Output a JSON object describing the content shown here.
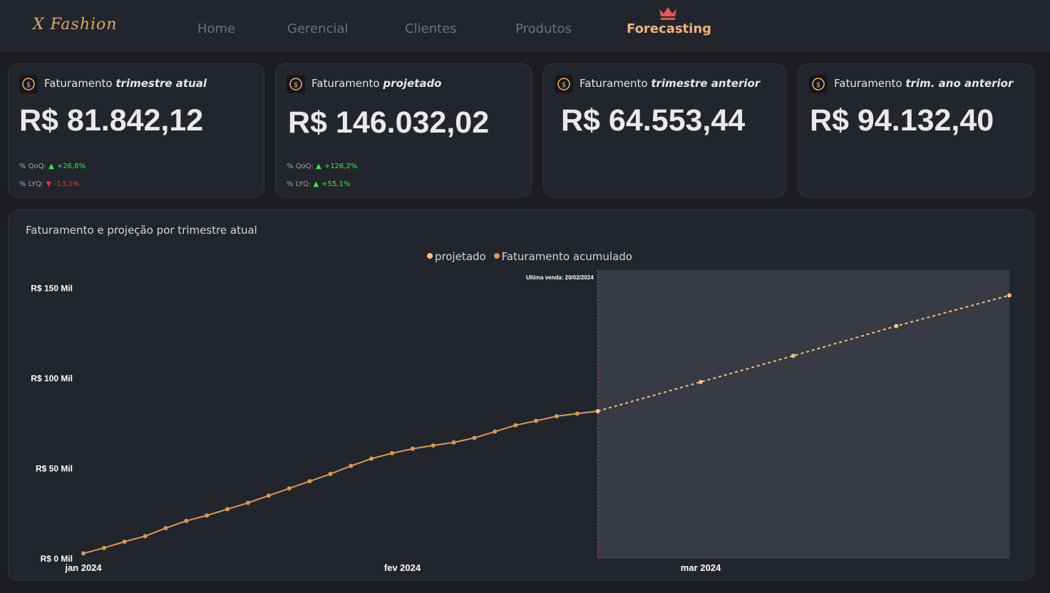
{
  "app": {
    "logo": "X Fashion"
  },
  "nav": {
    "items": [
      {
        "label": "Home"
      },
      {
        "label": "Gerencial"
      },
      {
        "label": "Clientes"
      },
      {
        "label": "Produtos"
      },
      {
        "label": "Forecasting"
      }
    ],
    "active": "Forecasting",
    "active_icon": "crown-icon",
    "active_color": "#f2b37b"
  },
  "cards": [
    {
      "title_prefix": "Faturamento",
      "title_emphasis": "trimestre atual",
      "value": "R$ 81.842,12",
      "qoq_label": "% QoQ:",
      "qoq_value": "+26,8%",
      "qoq_direction": "up",
      "lyq_label": "% LYQ:",
      "lyq_value": "-13,1%",
      "lyq_direction": "down"
    },
    {
      "title_prefix": "Faturamento",
      "title_emphasis": "projetado",
      "value": "R$ 146.032,02",
      "qoq_label": "% QoQ:",
      "qoq_value": "+126,2%",
      "qoq_direction": "up",
      "lyq_label": "% LYQ:",
      "lyq_value": "+55,1%",
      "lyq_direction": "up"
    },
    {
      "title_prefix": "Faturamento",
      "title_emphasis": "trimestre anterior",
      "value": "R$ 64.553,44"
    },
    {
      "title_prefix": "Faturamento",
      "title_emphasis": "trim. ano anterior",
      "value": "R$ 94.132,40"
    }
  ],
  "chart_panel": {
    "title": "Faturamento e projeção por trimestre atual",
    "legend": [
      {
        "name": "projetado",
        "color": "#f4c185"
      },
      {
        "name": "Faturamento acumulado",
        "color": "#d49a5c"
      }
    ]
  },
  "chart_data": {
    "type": "line",
    "x_range": [
      "2024-01-01",
      "2024-03-31"
    ],
    "x_ticks": [
      {
        "date": "2024-01-01",
        "label": "jan 2024"
      },
      {
        "date": "2024-02-01",
        "label": "fev 2024"
      },
      {
        "date": "2024-03-01",
        "label": "mar 2024"
      }
    ],
    "y_ticks": [
      {
        "value": 0,
        "label": "R$ 0 Mil"
      },
      {
        "value": 50000,
        "label": "R$ 50 Mil"
      },
      {
        "value": 100000,
        "label": "R$ 100 Mil"
      },
      {
        "value": 150000,
        "label": "R$ 150 Mil"
      }
    ],
    "ylim": [
      0,
      160000
    ],
    "annotation": {
      "date": "2024-02-20",
      "label": "Ultima venda: 20/02/2024"
    },
    "projection_start": "2024-02-20",
    "projection_end": "2024-03-31",
    "series": [
      {
        "name": "Faturamento acumulado",
        "color": "#d49a5c",
        "points": [
          [
            "2024-01-01",
            3000
          ],
          [
            "2024-01-03",
            6000
          ],
          [
            "2024-01-05",
            9500
          ],
          [
            "2024-01-07",
            12500
          ],
          [
            "2024-01-09",
            17000
          ],
          [
            "2024-01-11",
            21000
          ],
          [
            "2024-01-13",
            24000
          ],
          [
            "2024-01-15",
            27500
          ],
          [
            "2024-01-17",
            31000
          ],
          [
            "2024-01-19",
            35000
          ],
          [
            "2024-01-21",
            39000
          ],
          [
            "2024-01-23",
            43000
          ],
          [
            "2024-01-25",
            47000
          ],
          [
            "2024-01-27",
            51500
          ],
          [
            "2024-01-29",
            55500
          ],
          [
            "2024-01-31",
            58500
          ],
          [
            "2024-02-02",
            61000
          ],
          [
            "2024-02-04",
            62800
          ],
          [
            "2024-02-06",
            64500
          ],
          [
            "2024-02-08",
            67000
          ],
          [
            "2024-02-10",
            70500
          ],
          [
            "2024-02-12",
            74000
          ],
          [
            "2024-02-14",
            76500
          ],
          [
            "2024-02-16",
            79000
          ],
          [
            "2024-02-18",
            80500
          ],
          [
            "2024-02-20",
            81842
          ]
        ]
      },
      {
        "name": "projetado",
        "color": "#f4c185",
        "points": [
          [
            "2024-02-20",
            81842
          ],
          [
            "2024-03-01",
            98000
          ],
          [
            "2024-03-10",
            112500
          ],
          [
            "2024-03-20",
            129000
          ],
          [
            "2024-03-31",
            146032
          ]
        ]
      }
    ]
  }
}
